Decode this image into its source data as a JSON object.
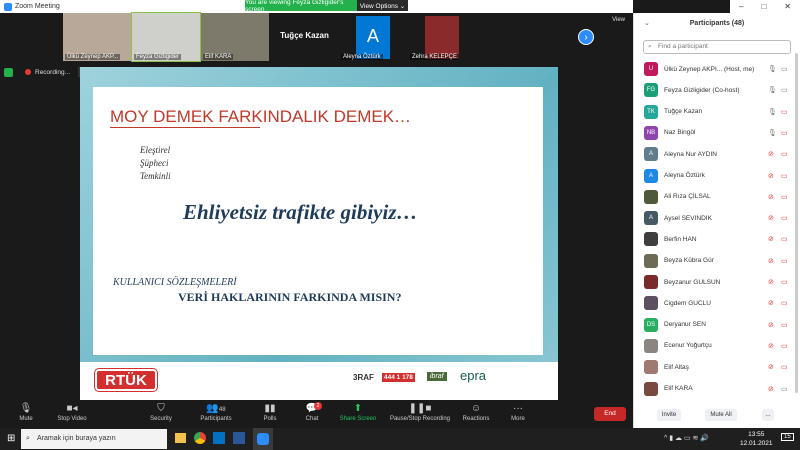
{
  "window": {
    "title": "Zoom Meeting"
  },
  "banner": {
    "text": "You are viewing Feyza Gizligider's screen",
    "view_options": "View Options ⌄"
  },
  "gallery": {
    "thumbs": [
      "Ülkü Zeynep AKP...",
      "Feyza Gizligider",
      "Elif KARA",
      "Tuğçe Kazan",
      "Aleyna Öztürk",
      "Zehra KELEPÇE"
    ],
    "avatar_letter": "A",
    "view_label": "View"
  },
  "recording": {
    "label": "Recording..."
  },
  "slide": {
    "title": "MOY DEMEK FARKINDALIK DEMEK…",
    "list": [
      "Eleştirel",
      "Şüpheci",
      "Temkinli"
    ],
    "headline": "Ehliyetsiz trafikte gibiyiz…",
    "sub1": "KULLANICI SÖZLEŞMELERİ",
    "sub2": "VERİ HAKLARININ FARKINDA MISIN?",
    "logo": "RTÜK",
    "hotline": "444 1 178",
    "logos": [
      "3RAF",
      "ibraf",
      "epra"
    ]
  },
  "participants": {
    "title": "Participants (48)",
    "search_placeholder": "Find a participant",
    "items": [
      {
        "initials": "U",
        "name": "Ülkü Zeynep AKPI...  (Host, me)",
        "color": "#c2185b",
        "mic": "on",
        "cam": "on"
      },
      {
        "initials": "FG",
        "name": "Feyza Gizligider (Co-host)",
        "color": "#1b9e77",
        "mic": "on",
        "cam": "on"
      },
      {
        "initials": "TK",
        "name": "Tuğçe Kazan",
        "color": "#26a69a",
        "mic": "on",
        "cam": "off"
      },
      {
        "initials": "NB",
        "name": "Naz Bingöl",
        "color": "#8e44ad",
        "mic": "on",
        "cam": "off"
      },
      {
        "initials": "A",
        "name": "Aleyna Nur AYDIN",
        "color": "#607d8b",
        "mic": "off",
        "cam": "off"
      },
      {
        "initials": "A",
        "name": "Aleyna Öztürk",
        "color": "#1e88e5",
        "mic": "off",
        "cam": "off"
      },
      {
        "initials": "",
        "name": "Ali Rıza ÇİLSAL",
        "color": "#4e5a3a",
        "mic": "off",
        "cam": "off"
      },
      {
        "initials": "A",
        "name": "Aysel SEVINDIK",
        "color": "#455a64",
        "mic": "off",
        "cam": "off"
      },
      {
        "initials": "",
        "name": "Berfin HAN",
        "color": "#3e3e3e",
        "mic": "off",
        "cam": "off"
      },
      {
        "initials": "",
        "name": "Beyza Kübra Gür",
        "color": "#6d6a55",
        "mic": "off",
        "cam": "off"
      },
      {
        "initials": "",
        "name": "Beyzanur GULSUN",
        "color": "#7a2a2a",
        "mic": "off",
        "cam": "off"
      },
      {
        "initials": "",
        "name": "Cigdem GUCLU",
        "color": "#5a5060",
        "mic": "off",
        "cam": "off"
      },
      {
        "initials": "DS",
        "name": "Deryanur SEN",
        "color": "#27ae60",
        "mic": "off",
        "cam": "off"
      },
      {
        "initials": "",
        "name": "Ecenur Yoğurtçu",
        "color": "#8a8580",
        "mic": "off",
        "cam": "off"
      },
      {
        "initials": "",
        "name": "Elif Altaş",
        "color": "#a07a70",
        "mic": "off",
        "cam": "off"
      },
      {
        "initials": "",
        "name": "Elif KARA",
        "color": "#7a4a40",
        "mic": "off",
        "cam": "on"
      }
    ],
    "invite": "Invite",
    "mute_all": "Mute All",
    "more": "..."
  },
  "toolbar": {
    "mute": "Mute",
    "stop_video": "Stop Video",
    "security": "Security",
    "participants": "Participants",
    "participants_count": "48",
    "polls": "Polls",
    "chat": "Chat",
    "chat_badge": "2",
    "share": "Share Screen",
    "recording": "Pause/Stop Recording",
    "reactions": "Reactions",
    "more": "More",
    "end": "End"
  },
  "taskbar": {
    "search_placeholder": "Aramak için buraya yazın",
    "time": "13:55",
    "date": "12.01.2021",
    "notifications": "15"
  }
}
